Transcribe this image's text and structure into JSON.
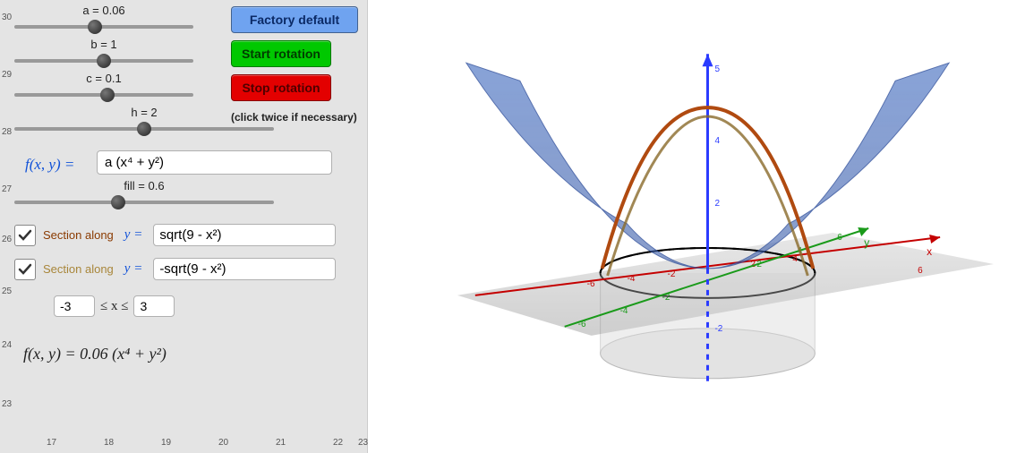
{
  "sliders": {
    "a": {
      "label": "a = 0.06",
      "pos": 45
    },
    "b": {
      "label": "b = 1",
      "pos": 50
    },
    "c": {
      "label": "c = 0.1",
      "pos": 52
    },
    "h": {
      "label": "h = 2",
      "pos": 50
    },
    "fill": {
      "label": "fill = 0.6",
      "pos": 40
    }
  },
  "buttons": {
    "factory": "Factory default",
    "start": "Start rotation",
    "stop": "Stop rotation",
    "hint": "(click twice if necessary)"
  },
  "fx": {
    "lhs": "f(x, y)  =",
    "rhs": "a (x⁴ + y²)"
  },
  "sections": {
    "s1": {
      "label": "Section along",
      "yeq": "y =",
      "val": "sqrt(9 - x²)",
      "checked": true,
      "color": "#8a3a00"
    },
    "s2": {
      "label": "Section along",
      "yeq": "y =",
      "val": "-sqrt(9 - x²)",
      "checked": true,
      "color": "#a8863a"
    }
  },
  "xrange": {
    "low": "-3",
    "mid": "≤ x ≤",
    "high": "3"
  },
  "formula": "f(x, y) = 0.06 (x⁴ + y²)",
  "axis_left": [
    "30",
    "29",
    "28",
    "27",
    "26",
    "25",
    "24",
    "23"
  ],
  "axis_bottom": [
    "17",
    "18",
    "19",
    "20",
    "21",
    "22",
    "23"
  ],
  "chart_data": {
    "type": "3d-surface",
    "function": "f(x,y) = 0.06 (x^4 + y^2)",
    "parameters": {
      "a": 0.06,
      "b": 1,
      "c": 0.1,
      "h": 2,
      "fill": 0.6
    },
    "sections": [
      {
        "curve": "y = sqrt(9 - x^2)",
        "color": "#b04a10",
        "enabled": true
      },
      {
        "curve": "y = -sqrt(9 - x^2)",
        "color": "#b08a3a",
        "enabled": true
      }
    ],
    "domain": {
      "x": [
        -3,
        3
      ]
    },
    "axes": {
      "x": {
        "range": [
          -6,
          6
        ],
        "color": "#c40000"
      },
      "y": {
        "range": [
          -6,
          6
        ],
        "color": "#1a9a1a"
      },
      "z": {
        "range": [
          -2,
          5
        ],
        "color": "#2a3bff"
      }
    },
    "xy_plane": true,
    "cylinder": {
      "radius": 3,
      "height": 4
    }
  },
  "axis3d": {
    "x": {
      "ticks": [
        "-6",
        "-4",
        "-2",
        "2",
        "4",
        "6"
      ],
      "label": "x"
    },
    "y": {
      "ticks": [
        "-6",
        "-4",
        "-2",
        "2",
        "4",
        "6"
      ],
      "label": "y"
    },
    "z": {
      "ticks": [
        "-2",
        "2",
        "4",
        "5"
      ],
      "label": ""
    }
  }
}
